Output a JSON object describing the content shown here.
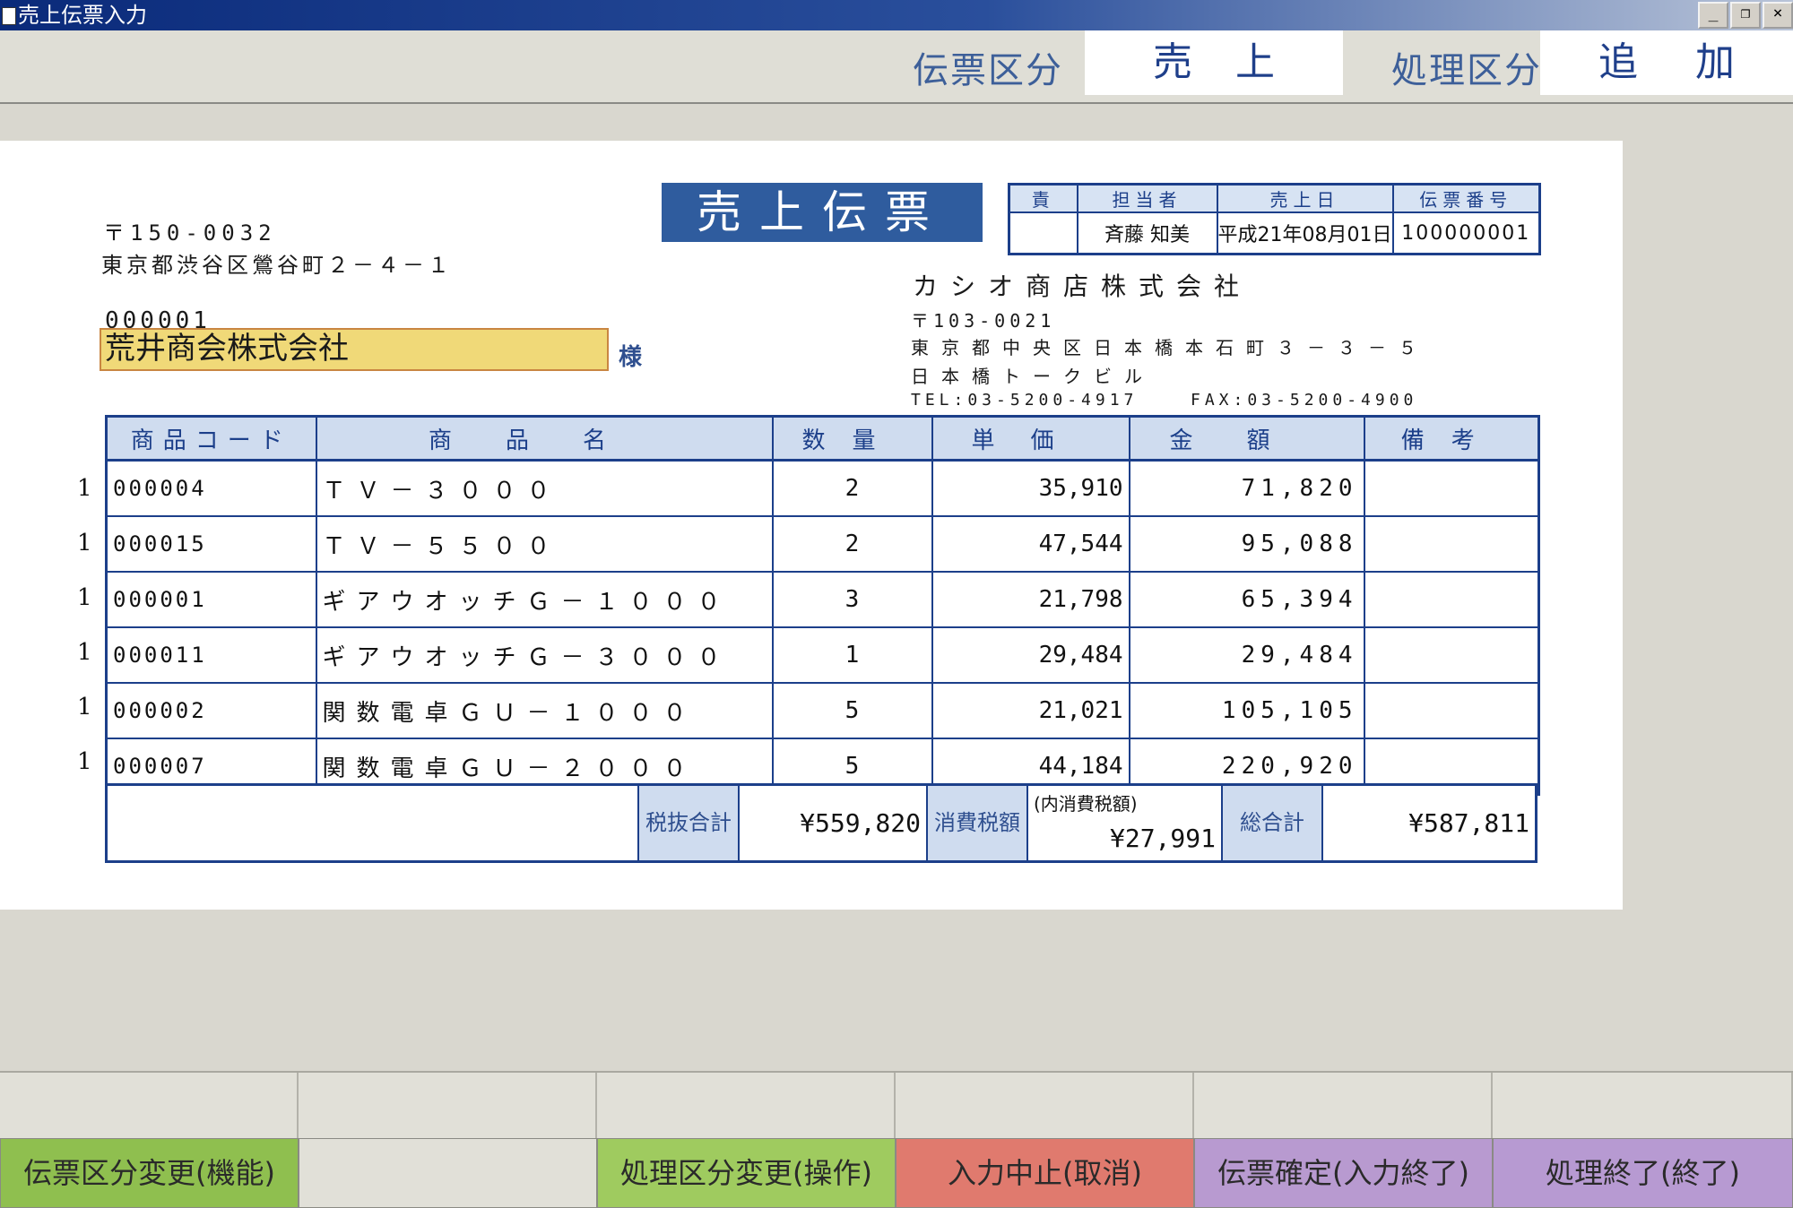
{
  "window": {
    "title": "売上伝票入力",
    "minimize": "_",
    "restore": "❐",
    "close": "×"
  },
  "header": {
    "slip_type_label": "伝票区分",
    "slip_type_value": "売上",
    "process_type_label": "処理区分",
    "process_type_value": "追加"
  },
  "slip": {
    "title": "売上伝票",
    "customer": {
      "postal": "〒150-0032",
      "address": "東京都渋谷区鶯谷町２－４－１",
      "code": "000001",
      "name": "荒井商会株式会社",
      "honorific": "様"
    },
    "info": {
      "headers": [
        "責",
        "担当者",
        "売上日",
        "伝票番号"
      ],
      "values": [
        "",
        "斉藤 知美",
        "平成21年08月01日",
        "100000001"
      ]
    },
    "company": {
      "name": "カシオ商店株式会社",
      "postal": "〒103-0021",
      "address1": "東京都中央区日本橋本石町３－３－５",
      "address2": "日本橋トークビル",
      "tel": "TEL:03-5200-4917",
      "fax": "FAX:03-5200-4900"
    },
    "columns": [
      "商品コード",
      "商品名",
      "数量",
      "単価",
      "金額",
      "備考"
    ],
    "rows": [
      {
        "line": "1",
        "code": "000004",
        "name": "ＴＶ－３０００",
        "qty": "2",
        "price": "35,910",
        "amount": "71,820",
        "note": ""
      },
      {
        "line": "1",
        "code": "000015",
        "name": "ＴＶ－５５００",
        "qty": "2",
        "price": "47,544",
        "amount": "95,088",
        "note": ""
      },
      {
        "line": "1",
        "code": "000001",
        "name": "ギアウオッチＧ－１０００",
        "qty": "3",
        "price": "21,798",
        "amount": "65,394",
        "note": ""
      },
      {
        "line": "1",
        "code": "000011",
        "name": "ギアウオッチＧ－３０００",
        "qty": "1",
        "price": "29,484",
        "amount": "29,484",
        "note": ""
      },
      {
        "line": "1",
        "code": "000002",
        "name": "関数電卓ＧＵ－１０００",
        "qty": "5",
        "price": "21,021",
        "amount": "105,105",
        "note": ""
      },
      {
        "line": "1",
        "code": "000007",
        "name": "関数電卓ＧＵ－２０００",
        "qty": "5",
        "price": "44,184",
        "amount": "220,920",
        "note": ""
      }
    ],
    "totals": {
      "subtotal_label": "税抜合計",
      "subtotal": "¥559,820",
      "tax_label": "消費税額",
      "tax_note": "(内消費税額)",
      "tax": "¥27,991",
      "total_label": "総合計",
      "total": "¥587,811"
    }
  },
  "function_keys": [
    {
      "label": "伝票区分変更(機能)",
      "color": "#8fbf4f"
    },
    {
      "label": "",
      "color": "#e1e0d8"
    },
    {
      "label": "処理区分変更(操作)",
      "color": "#9fcb5f"
    },
    {
      "label": "入力中止(取消)",
      "color": "#e07a6e"
    },
    {
      "label": "伝票確定(入力終了)",
      "color": "#b89ad0"
    },
    {
      "label": "処理終了(終了)",
      "color": "#b79ad2"
    }
  ]
}
